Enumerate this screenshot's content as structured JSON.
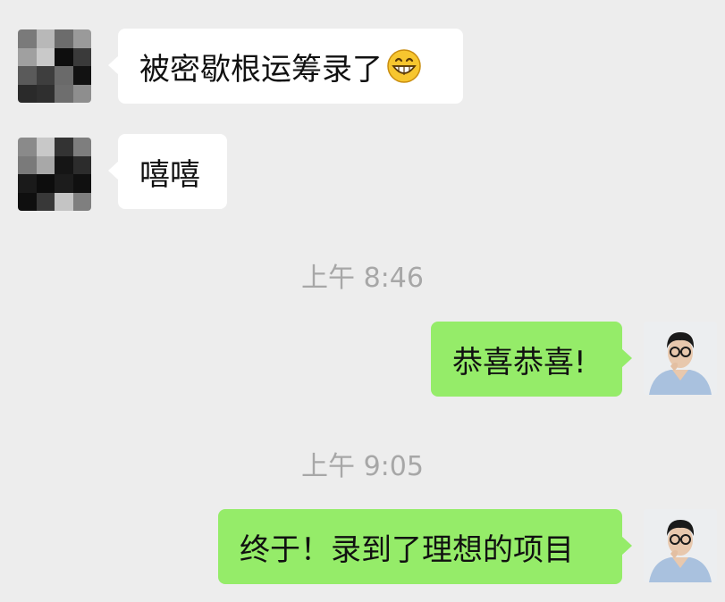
{
  "messages": [
    {
      "side": "in",
      "text": "被密歇根运筹录了",
      "emoji": "grinning-face"
    },
    {
      "side": "in",
      "text": "嘻嘻"
    },
    {
      "type": "timestamp",
      "text": "上午 8:46"
    },
    {
      "side": "out",
      "text": "恭喜恭喜!"
    },
    {
      "type": "timestamp",
      "text": "上午 9:05"
    },
    {
      "side": "out",
      "text": "终于！录到了理想的项目"
    }
  ],
  "colors": {
    "background": "#ededed",
    "incoming_bubble": "#ffffff",
    "outgoing_bubble": "#95ec69",
    "timestamp_text": "#a7a7a7"
  }
}
